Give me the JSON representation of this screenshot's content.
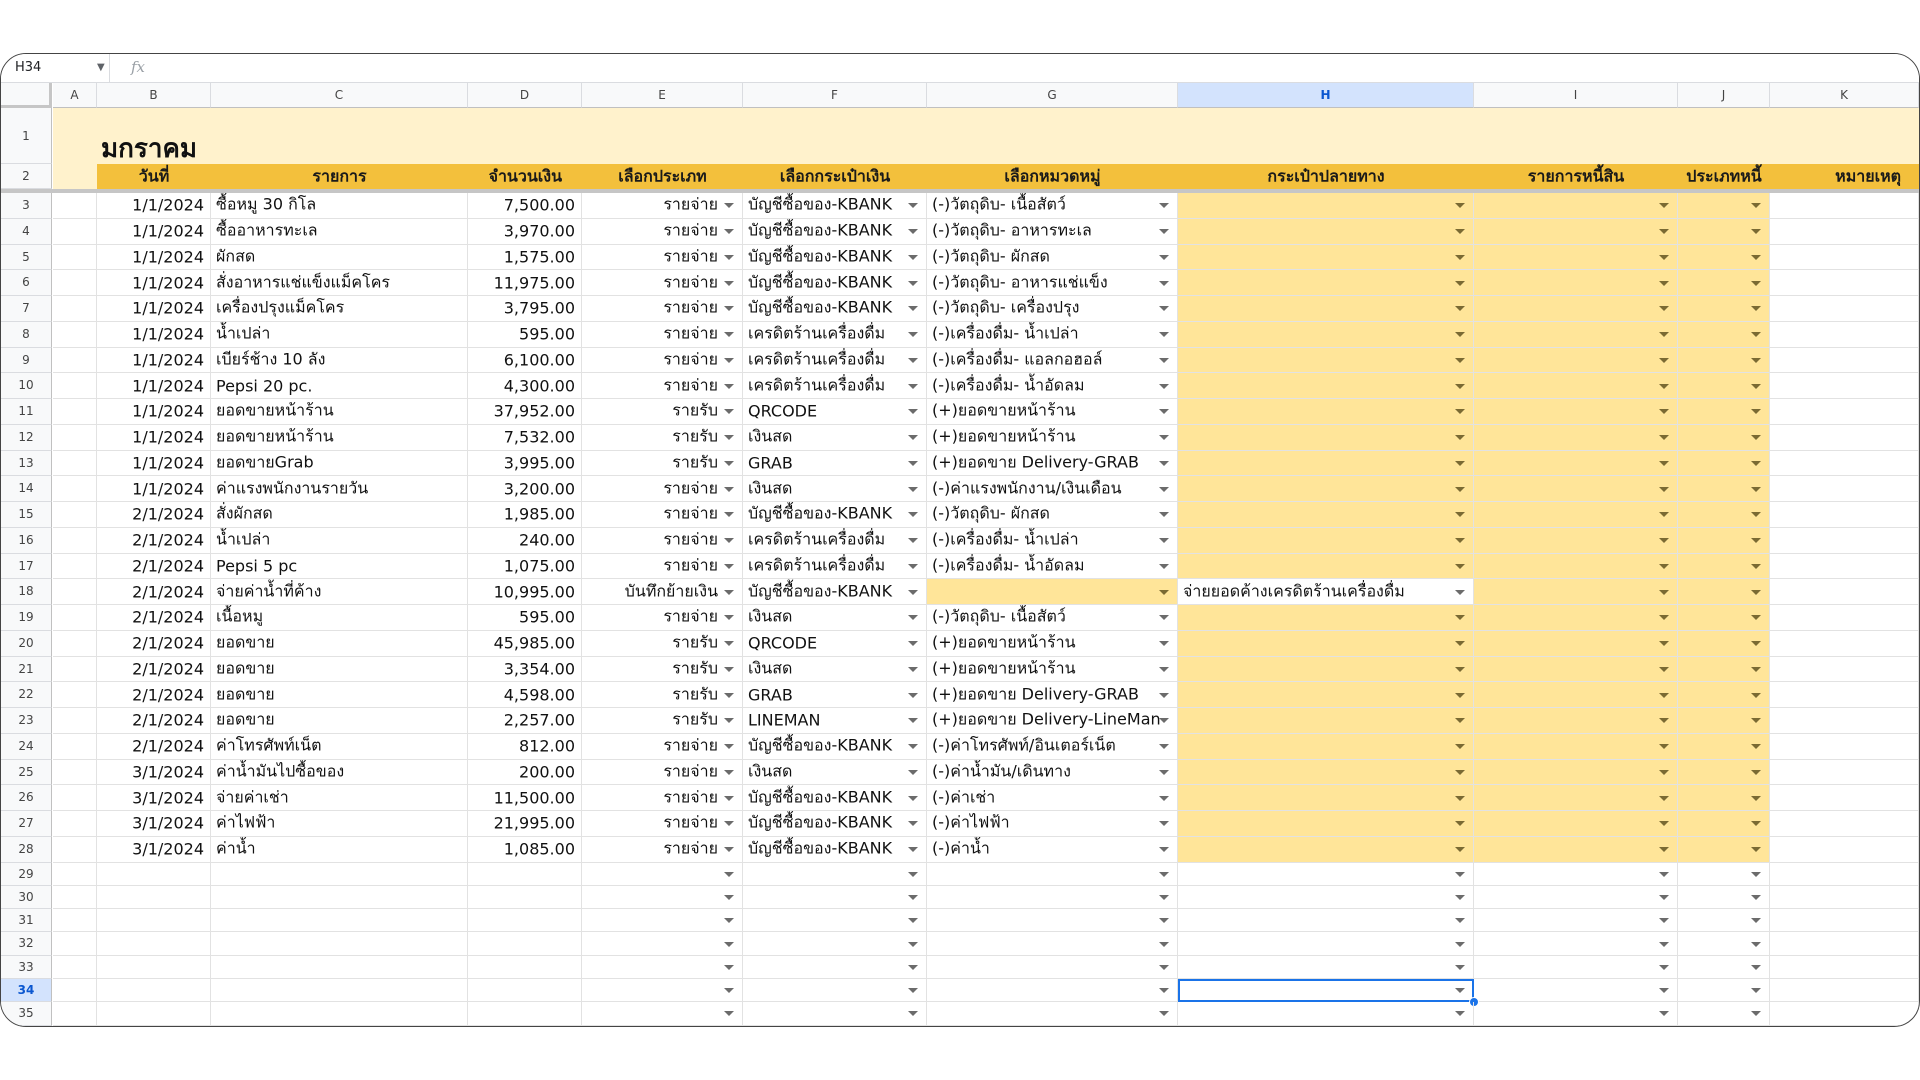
{
  "name_box": "H34",
  "fx_label": "fx",
  "selected_col": "H",
  "selected_row": "34",
  "columns": [
    "A",
    "B",
    "C",
    "D",
    "E",
    "F",
    "G",
    "H",
    "I",
    "J",
    "K"
  ],
  "sheet_title": "มกราคม",
  "header_labels": [
    "วันที่",
    "รายการ",
    "จำนวนเงิน",
    "เลือกประเภท",
    "เลือกกระเป๋าเงิน",
    "เลือกหมวดหมู่",
    "กระเป๋าปลายทาง",
    "รายการหนี้สิน",
    "ประเภทหนี้",
    "หมายเหตุ"
  ],
  "rows": [
    {
      "n": "3",
      "date": "1/1/2024",
      "item": "ซื้อหมู 30 กิโล",
      "amount": "7,500.00",
      "type": "รายจ่าย",
      "wallet": "บัญชีซื้อของ-KBANK",
      "category": "(-)วัตถุดิบ- เนื้อสัตว์",
      "dest": ""
    },
    {
      "n": "4",
      "date": "1/1/2024",
      "item": "ซื้ออาหารทะเล",
      "amount": "3,970.00",
      "type": "รายจ่าย",
      "wallet": "บัญชีซื้อของ-KBANK",
      "category": "(-)วัตถุดิบ- อาหารทะเล",
      "dest": ""
    },
    {
      "n": "5",
      "date": "1/1/2024",
      "item": "ผักสด",
      "amount": "1,575.00",
      "type": "รายจ่าย",
      "wallet": "บัญชีซื้อของ-KBANK",
      "category": "(-)วัตถุดิบ- ผักสด",
      "dest": ""
    },
    {
      "n": "6",
      "date": "1/1/2024",
      "item": "สั่งอาหารแช่แข็งแม็คโคร",
      "amount": "11,975.00",
      "type": "รายจ่าย",
      "wallet": "บัญชีซื้อของ-KBANK",
      "category": "(-)วัตถุดิบ- อาหารแช่แข็ง",
      "dest": ""
    },
    {
      "n": "7",
      "date": "1/1/2024",
      "item": "เครื่องปรุงแม็คโคร",
      "amount": "3,795.00",
      "type": "รายจ่าย",
      "wallet": "บัญชีซื้อของ-KBANK",
      "category": "(-)วัตถุดิบ- เครื่องปรุง",
      "dest": ""
    },
    {
      "n": "8",
      "date": "1/1/2024",
      "item": "น้ำเปล่า",
      "amount": "595.00",
      "type": "รายจ่าย",
      "wallet": "เครดิตร้านเครื่องดื่ม",
      "category": "(-)เครื่องดื่ม- น้ำเปล่า",
      "dest": ""
    },
    {
      "n": "9",
      "date": "1/1/2024",
      "item": "เบียร์ช้าง 10 ลัง",
      "amount": "6,100.00",
      "type": "รายจ่าย",
      "wallet": "เครดิตร้านเครื่องดื่ม",
      "category": "(-)เครื่องดื่ม- แอลกอฮอล์",
      "dest": ""
    },
    {
      "n": "10",
      "date": "1/1/2024",
      "item": "Pepsi 20 pc.",
      "amount": "4,300.00",
      "type": "รายจ่าย",
      "wallet": "เครดิตร้านเครื่องดื่ม",
      "category": "(-)เครื่องดื่ม- น้ำอัดลม",
      "dest": ""
    },
    {
      "n": "11",
      "date": "1/1/2024",
      "item": "ยอดขายหน้าร้าน",
      "amount": "37,952.00",
      "type": "รายรับ",
      "wallet": "QRCODE",
      "category": "(+)ยอดขายหน้าร้าน",
      "dest": ""
    },
    {
      "n": "12",
      "date": "1/1/2024",
      "item": "ยอดขายหน้าร้าน",
      "amount": "7,532.00",
      "type": "รายรับ",
      "wallet": "เงินสด",
      "category": "(+)ยอดขายหน้าร้าน",
      "dest": ""
    },
    {
      "n": "13",
      "date": "1/1/2024",
      "item": "ยอดขายGrab",
      "amount": "3,995.00",
      "type": "รายรับ",
      "wallet": "GRAB",
      "category": "(+)ยอดขาย Delivery-GRAB",
      "dest": ""
    },
    {
      "n": "14",
      "date": "1/1/2024",
      "item": "ค่าแรงพนักงานรายวัน",
      "amount": "3,200.00",
      "type": "รายจ่าย",
      "wallet": "เงินสด",
      "category": "(-)ค่าแรงพนักงาน/เงินเดือน",
      "dest": ""
    },
    {
      "n": "15",
      "date": "2/1/2024",
      "item": "สั่งผักสด",
      "amount": "1,985.00",
      "type": "รายจ่าย",
      "wallet": "บัญชีซื้อของ-KBANK",
      "category": "(-)วัตถุดิบ- ผักสด",
      "dest": ""
    },
    {
      "n": "16",
      "date": "2/1/2024",
      "item": "น้ำเปล่า",
      "amount": "240.00",
      "type": "รายจ่าย",
      "wallet": "เครดิตร้านเครื่องดื่ม",
      "category": "(-)เครื่องดื่ม- น้ำเปล่า",
      "dest": ""
    },
    {
      "n": "17",
      "date": "2/1/2024",
      "item": "Pepsi 5 pc",
      "amount": "1,075.00",
      "type": "รายจ่าย",
      "wallet": "เครดิตร้านเครื่องดื่ม",
      "category": "(-)เครื่องดื่ม- น้ำอัดลม",
      "dest": ""
    },
    {
      "n": "18",
      "date": "2/1/2024",
      "item": "จ่ายค่าน้ำที่ค้าง",
      "amount": "10,995.00",
      "type": "บันทึกย้ายเงิน",
      "wallet": "บัญชีซื้อของ-KBANK",
      "category": "",
      "dest": "จ่ายยอดค้างเครดิตร้านเครื่องดื่ม"
    },
    {
      "n": "19",
      "date": "2/1/2024",
      "item": "เนื้อหมู",
      "amount": "595.00",
      "type": "รายจ่าย",
      "wallet": "เงินสด",
      "category": "(-)วัตถุดิบ- เนื้อสัตว์",
      "dest": ""
    },
    {
      "n": "20",
      "date": "2/1/2024",
      "item": "ยอดขาย",
      "amount": "45,985.00",
      "type": "รายรับ",
      "wallet": "QRCODE",
      "category": "(+)ยอดขายหน้าร้าน",
      "dest": ""
    },
    {
      "n": "21",
      "date": "2/1/2024",
      "item": "ยอดขาย",
      "amount": "3,354.00",
      "type": "รายรับ",
      "wallet": "เงินสด",
      "category": "(+)ยอดขายหน้าร้าน",
      "dest": ""
    },
    {
      "n": "22",
      "date": "2/1/2024",
      "item": "ยอดขาย",
      "amount": "4,598.00",
      "type": "รายรับ",
      "wallet": "GRAB",
      "category": "(+)ยอดขาย Delivery-GRAB",
      "dest": ""
    },
    {
      "n": "23",
      "date": "2/1/2024",
      "item": "ยอดขาย",
      "amount": "2,257.00",
      "type": "รายรับ",
      "wallet": "LINEMAN",
      "category": "(+)ยอดขาย Delivery-LineMan",
      "dest": ""
    },
    {
      "n": "24",
      "date": "2/1/2024",
      "item": "ค่าโทรศัพท์เน็ต",
      "amount": "812.00",
      "type": "รายจ่าย",
      "wallet": "บัญชีซื้อของ-KBANK",
      "category": "(-)ค่าโทรศัพท์/อินเตอร์เน็ต",
      "dest": ""
    },
    {
      "n": "25",
      "date": "3/1/2024",
      "item": "ค่าน้ำมันไปซื้อของ",
      "amount": "200.00",
      "type": "รายจ่าย",
      "wallet": "เงินสด",
      "category": "(-)ค่าน้ำมัน/เดินทาง",
      "dest": ""
    },
    {
      "n": "26",
      "date": "3/1/2024",
      "item": "จ่ายค่าเช่า",
      "amount": "11,500.00",
      "type": "รายจ่าย",
      "wallet": "บัญชีซื้อของ-KBANK",
      "category": "(-)ค่าเช่า",
      "dest": ""
    },
    {
      "n": "27",
      "date": "3/1/2024",
      "item": "ค่าไฟฟ้า",
      "amount": "21,995.00",
      "type": "รายจ่าย",
      "wallet": "บัญชีซื้อของ-KBANK",
      "category": "(-)ค่าไฟฟ้า",
      "dest": ""
    },
    {
      "n": "28",
      "date": "3/1/2024",
      "item": "ค่าน้ำ",
      "amount": "1,085.00",
      "type": "รายจ่าย",
      "wallet": "บัญชีซื้อของ-KBANK",
      "category": "(-)ค่าน้ำ",
      "dest": ""
    }
  ],
  "empty_rows": [
    "29",
    "30",
    "31",
    "32",
    "33",
    "34",
    "35"
  ],
  "colors": {
    "header_yellow": "#f3c03c",
    "title_band": "#fff2cc",
    "light_yellow": "#ffe599",
    "selection": "#1a73e8"
  }
}
